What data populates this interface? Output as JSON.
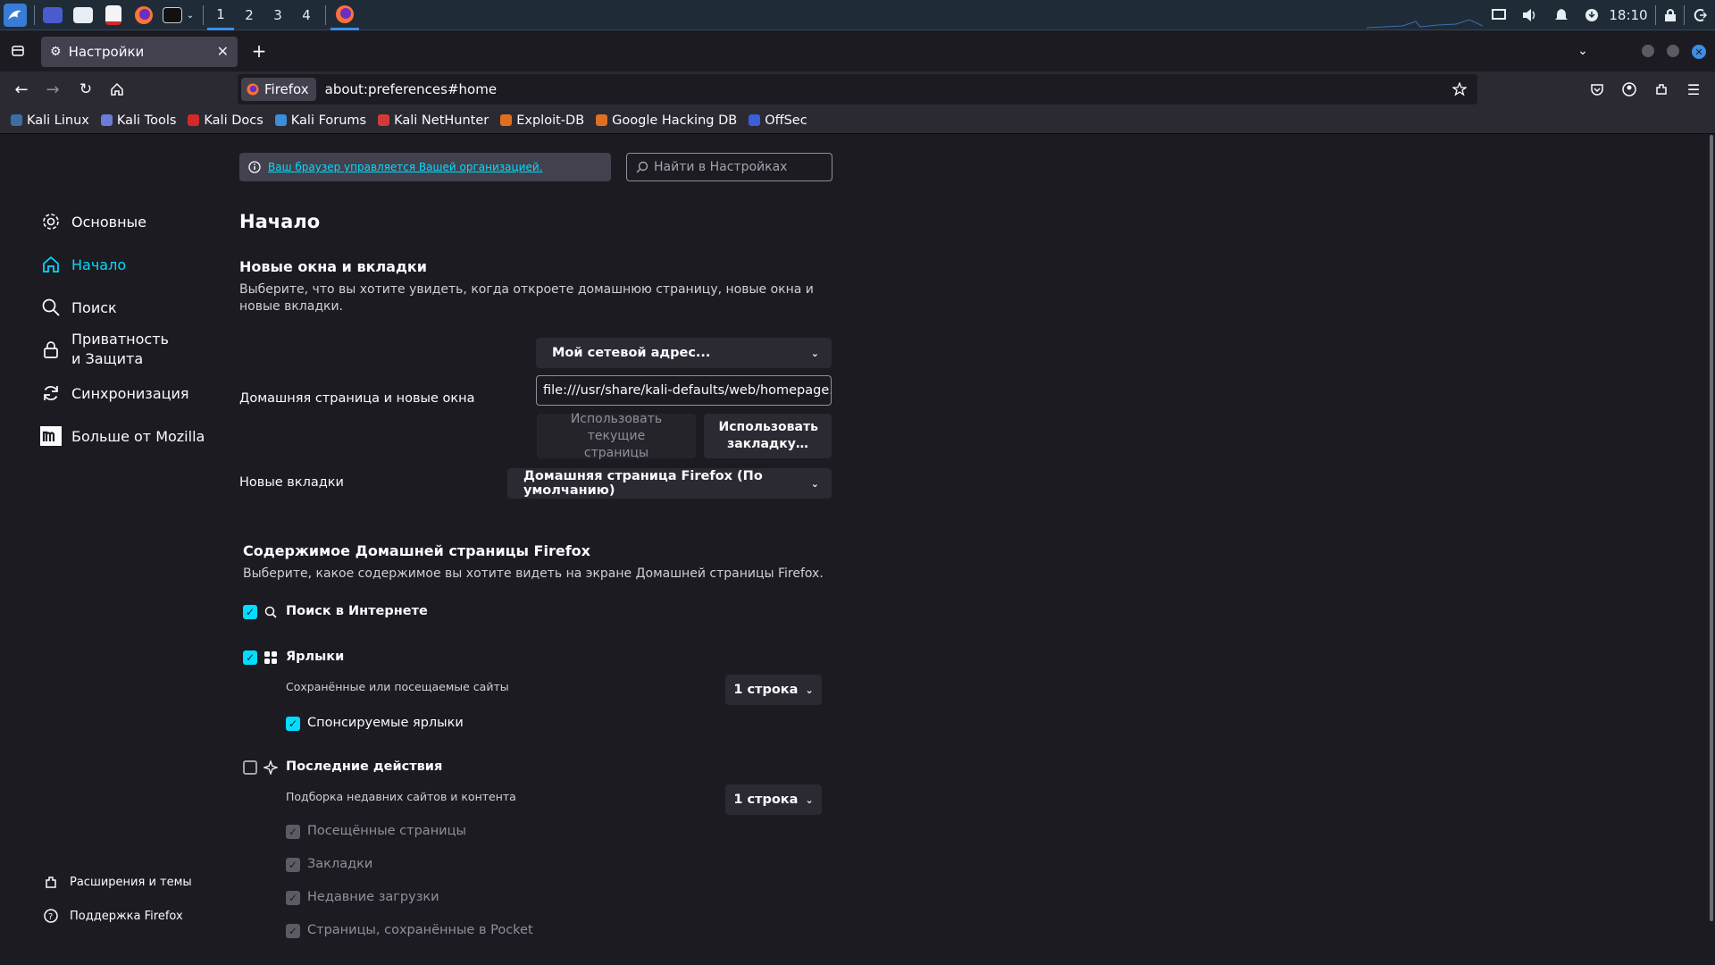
{
  "taskbar": {
    "workspaces": [
      "1",
      "2",
      "3",
      "4"
    ],
    "clock": "18:10"
  },
  "browser": {
    "tab_title": "Настройки",
    "identity_label": "Firefox",
    "url": "about:preferences#home"
  },
  "bookmarks": [
    {
      "label": "Kali Linux",
      "color": "#3b6ea5"
    },
    {
      "label": "Kali Tools",
      "color": "#6d7bd8"
    },
    {
      "label": "Kali Docs",
      "color": "#d22a2a"
    },
    {
      "label": "Kali Forums",
      "color": "#3b8ed8"
    },
    {
      "label": "Kali NetHunter",
      "color": "#d23a3a"
    },
    {
      "label": "Exploit-DB",
      "color": "#e0701f"
    },
    {
      "label": "Google Hacking DB",
      "color": "#e0701f"
    },
    {
      "label": "OffSec",
      "color": "#3a5fd8"
    }
  ],
  "sidebar": {
    "items": [
      {
        "label": "Основные",
        "icon": "gear-icon"
      },
      {
        "label": "Начало",
        "icon": "home-icon"
      },
      {
        "label": "Поиск",
        "icon": "search-icon"
      },
      {
        "label": "Приватность и Защита",
        "icon": "lock-icon"
      },
      {
        "label": "Синхронизация",
        "icon": "sync-icon"
      },
      {
        "label": "Больше от Mozilla",
        "icon": "mozilla-icon"
      }
    ],
    "footer": [
      {
        "label": "Расширения и темы",
        "icon": "puzzle-icon"
      },
      {
        "label": "Поддержка Firefox",
        "icon": "help-icon"
      }
    ]
  },
  "policy_notice": "Ваш браузер управляется Вашей организацией.",
  "search_placeholder": "Найти в Настройках",
  "page_title": "Начало",
  "section_windows": {
    "title": "Новые окна и вкладки",
    "description": "Выберите, что вы хотите увидеть, когда откроете домашнюю страницу, новые окна и новые вкладки.",
    "homepage_mode": "Мой сетевой адрес...",
    "homepage_label": "Домашняя страница и новые окна",
    "homepage_url": "file:///usr/share/kali-defaults/web/homepage.html",
    "use_current_pages": "Использовать текущие страницы",
    "use_bookmark": "Использовать закладку…",
    "newtabs_label": "Новые вкладки",
    "newtabs_value": "Домашняя страница Firefox (По умолчанию)"
  },
  "section_content": {
    "title": "Содержимое Домашней страницы Firefox",
    "description": "Выберите, какое содержимое вы хотите видеть на экране Домашней страницы Firefox.",
    "web_search": {
      "label": "Поиск в Интернете",
      "checked": true
    },
    "shortcuts": {
      "label": "Ярлыки",
      "checked": true,
      "sub": "Сохранённые или посещаемые сайты",
      "rows": "1 строка"
    },
    "sponsored": {
      "label": "Спонсируемые ярлыки",
      "checked": true
    },
    "recent": {
      "label": "Последние действия",
      "checked": false,
      "sub": "Подборка недавних сайтов и контента",
      "rows": "1 строка"
    },
    "recent_items": [
      "Посещённые страницы",
      "Закладки",
      "Недавние загрузки",
      "Страницы, сохранённые в Pocket"
    ]
  }
}
